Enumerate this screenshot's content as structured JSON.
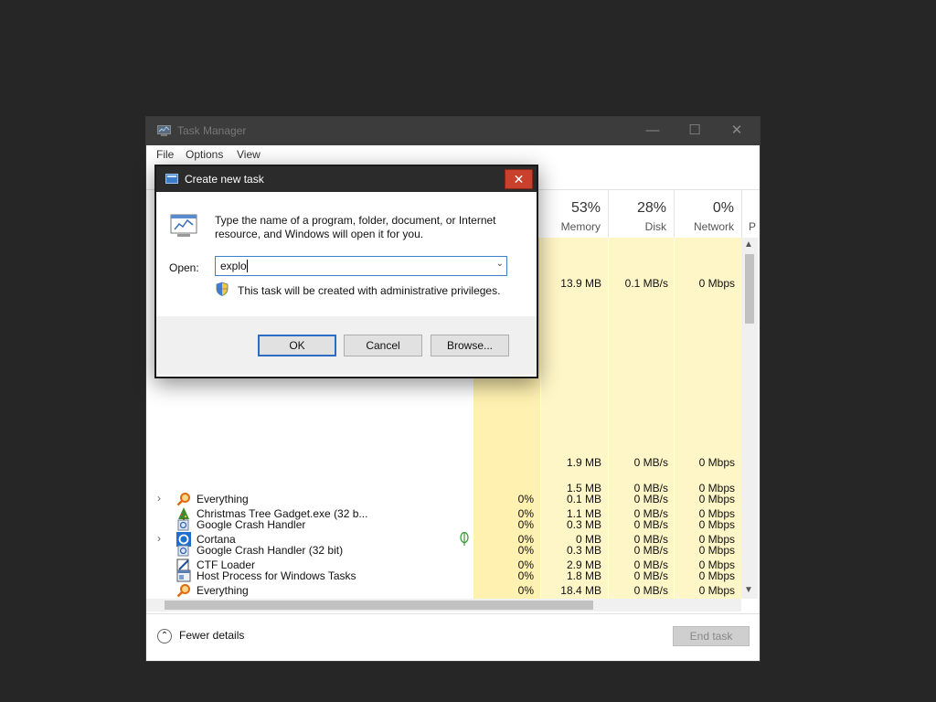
{
  "task_manager": {
    "title": "Task Manager",
    "menu": [
      "File",
      "Options",
      "View"
    ],
    "columns": [
      {
        "pct": "53%",
        "label": "Memory"
      },
      {
        "pct": "28%",
        "label": "Disk"
      },
      {
        "pct": "0%",
        "label": "Network"
      },
      {
        "pct": "",
        "label": "P"
      }
    ],
    "rows": [
      {
        "name": "",
        "cpu": "",
        "memory": "13.9 MB",
        "disk": "0.1 MB/s",
        "network": "0 Mbps",
        "expandable": false,
        "icon": "app-icon"
      },
      {
        "name": "",
        "cpu": "",
        "memory": "1.9 MB",
        "disk": "0 MB/s",
        "network": "0 Mbps",
        "expandable": false,
        "icon": "app-icon"
      },
      {
        "name": "",
        "cpu": "",
        "memory": "1.5 MB",
        "disk": "0 MB/s",
        "network": "0 Mbps",
        "expandable": false,
        "icon": "app-icon"
      },
      {
        "name": "Christmas Tree Gadget.exe (32 b...",
        "cpu": "0%",
        "memory": "1.1 MB",
        "disk": "0 MB/s",
        "network": "0 Mbps",
        "expandable": false,
        "icon": "tree-icon"
      },
      {
        "name": "Cortana",
        "cpu": "0%",
        "memory": "0 MB",
        "disk": "0 MB/s",
        "network": "0 Mbps",
        "expandable": true,
        "icon": "cortana-icon",
        "leaf": true
      },
      {
        "name": "CTF Loader",
        "cpu": "0%",
        "memory": "2.9 MB",
        "disk": "0 MB/s",
        "network": "0 Mbps",
        "expandable": false,
        "icon": "ctf-icon"
      },
      {
        "name": "Everything",
        "cpu": "0%",
        "memory": "18.4 MB",
        "disk": "0 MB/s",
        "network": "0 Mbps",
        "expandable": false,
        "icon": "magnifier-icon"
      },
      {
        "name": "Everything",
        "cpu": "0%",
        "memory": "0.1 MB",
        "disk": "0 MB/s",
        "network": "0 Mbps",
        "expandable": true,
        "icon": "magnifier-icon"
      },
      {
        "name": "Google Crash Handler",
        "cpu": "0%",
        "memory": "0.3 MB",
        "disk": "0 MB/s",
        "network": "0 Mbps",
        "expandable": false,
        "icon": "crash-handler-icon"
      },
      {
        "name": "Google Crash Handler (32 bit)",
        "cpu": "0%",
        "memory": "0.3 MB",
        "disk": "0 MB/s",
        "network": "0 Mbps",
        "expandable": false,
        "icon": "crash-handler-icon"
      },
      {
        "name": "Host Process for Windows Tasks",
        "cpu": "0%",
        "memory": "1.8 MB",
        "disk": "0 MB/s",
        "network": "0 Mbps",
        "expandable": false,
        "icon": "host-process-icon"
      }
    ],
    "fewer_details": "Fewer details",
    "end_task": "End task"
  },
  "dialog": {
    "title": "Create new task",
    "message_line1": "Type the name of a program, folder, document, or Internet",
    "message_line2": "resource, and Windows will open it for you.",
    "open_label": "Open:",
    "open_value": "explo",
    "admin_note": "This task will be created with administrative privileges.",
    "ok": "OK",
    "cancel": "Cancel",
    "browse": "Browse..."
  },
  "colors": {
    "desktop": "#262626",
    "highlight_column": "#fff6c7",
    "close_button": "#c9402c",
    "input_border": "#3b80c8"
  }
}
